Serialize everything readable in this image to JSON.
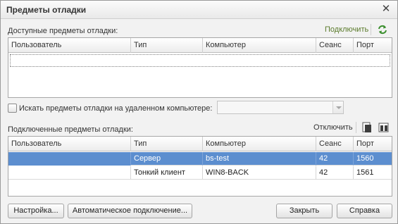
{
  "window": {
    "title": "Предметы отладки",
    "close": "✕"
  },
  "available": {
    "label": "Доступные предметы отладки:",
    "connect_label": "Подключить",
    "columns": [
      "Пользователь",
      "Тип",
      "Компьютер",
      "Сеанс",
      "Порт"
    ],
    "rows": []
  },
  "remote": {
    "label": "Искать предметы отладки на удаленном компьютере:",
    "checked": false,
    "value": ""
  },
  "connected": {
    "label": "Подключенные предметы отладки:",
    "disconnect_label": "Отключить",
    "columns": [
      "Пользователь",
      "Тип",
      "Компьютер",
      "Сеанс",
      "Порт"
    ],
    "rows": [
      {
        "user": "",
        "type": "Сервер",
        "computer": "bs-test",
        "session": "42",
        "port": "1560",
        "selected": true
      },
      {
        "user": "",
        "type": "Тонкий клиент",
        "computer": "WIN8-BACK",
        "session": "42",
        "port": "1561",
        "selected": false
      }
    ]
  },
  "buttons": {
    "settings": "Настройка...",
    "auto_connect": "Автоматическое подключение...",
    "close": "Закрыть",
    "help": "Справка"
  },
  "colors": {
    "accent_green": "#4a9a3a",
    "selection": "#5c8ecf",
    "link": "#5a7a2a"
  },
  "icons": {
    "refresh": "refresh-icon",
    "doc_a": "document-icon",
    "doc_b": "columns-icon"
  }
}
